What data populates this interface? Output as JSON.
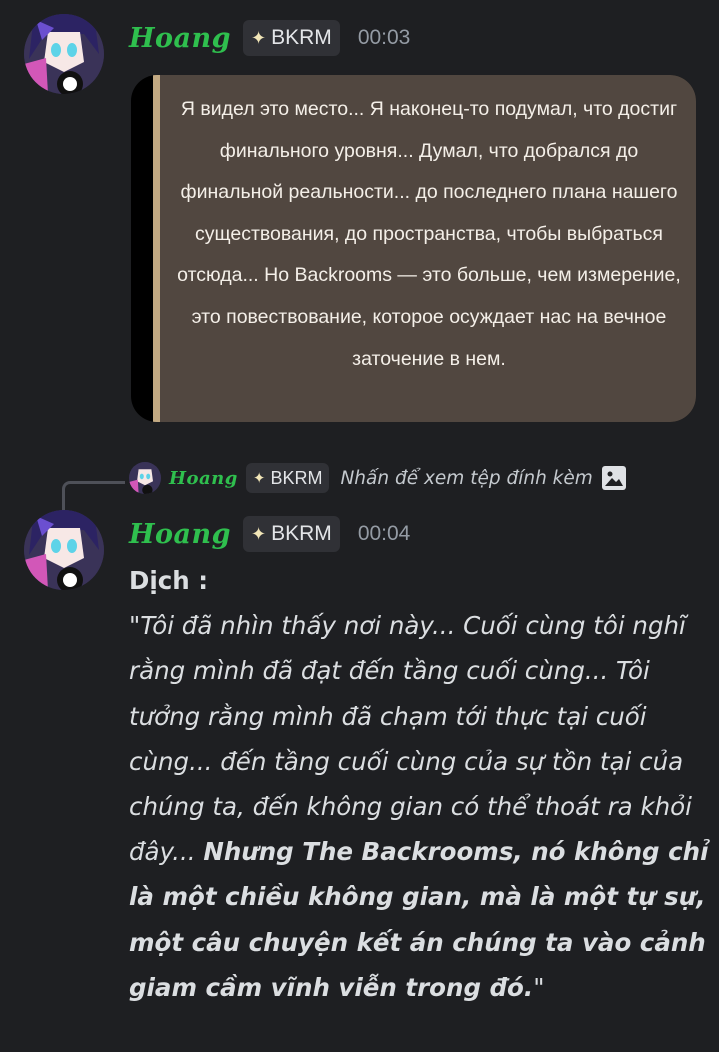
{
  "messages": [
    {
      "author": "Hoang",
      "tag": "BKRM",
      "timestamp": "00:03",
      "image_text": "Я видел это место... Я наконец-то подумал, что достиг финального уровня... Думал, что добрался до финальной реальности... до последнего плана нашего существования, до пространства, чтобы выбраться отсюда... Но Backrooms — это больше, чем измерение, это повествование, которое осуждает нас на вечное заточение в нем."
    },
    {
      "author": "Hoang",
      "tag": "BKRM",
      "timestamp": "00:04",
      "reply": {
        "author": "Hoang",
        "tag": "BKRM",
        "text": "Nhấn để xem tệp đính kèm"
      },
      "label": "Dịch :",
      "translation_plain": "\"Tôi đã nhìn thấy nơi này... Cuối cùng tôi nghĩ rằng mình đã đạt đến tầng cuối cùng... Tôi tưởng rằng mình đã chạm tới thực tại cuối cùng... đến tầng cuối cùng của sự tồn tại của chúng ta, đến không gian có thể thoát ra khỏi đây... ",
      "translation_bold": "Nhưng The Backrooms, nó không chỉ là một chiều không gian, mà là một tự sự, một câu chuyện kết án chúng ta vào cảnh giam cầm vĩnh viễn trong đó.",
      "translation_end": "\""
    }
  ],
  "icons": {
    "tag_icon": "gem-icon",
    "attachment_icon": "image-icon"
  },
  "colors": {
    "username": "#2fbf4e",
    "background": "#1e1f22",
    "image_bg": "#514740",
    "quote_bar": "#c2a982"
  }
}
